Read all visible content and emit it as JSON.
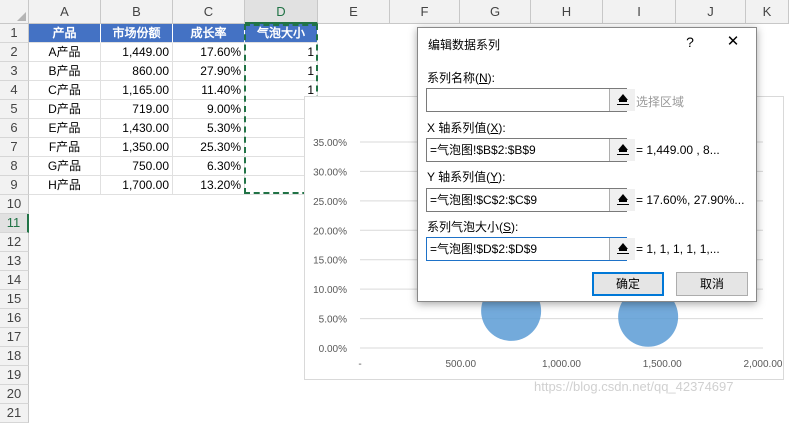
{
  "columns": [
    "A",
    "B",
    "C",
    "D",
    "E",
    "F",
    "G",
    "H",
    "I",
    "J",
    "K"
  ],
  "rows": [
    "1",
    "2",
    "3",
    "4",
    "5",
    "6",
    "7",
    "8",
    "9",
    "10",
    "11",
    "12",
    "13",
    "14",
    "15",
    "16",
    "17",
    "18",
    "19",
    "20",
    "21"
  ],
  "table": {
    "headers": [
      "产品",
      "市场份额",
      "成长率",
      "气泡大小"
    ],
    "rows": [
      [
        "A产品",
        "1,449.00",
        "17.60%",
        "1"
      ],
      [
        "B产品",
        "860.00",
        "27.90%",
        "1"
      ],
      [
        "C产品",
        "1,165.00",
        "11.40%",
        "1"
      ],
      [
        "D产品",
        "719.00",
        "9.00%",
        ""
      ],
      [
        "E产品",
        "1,430.00",
        "5.30%",
        ""
      ],
      [
        "F产品",
        "1,350.00",
        "25.30%",
        ""
      ],
      [
        "G产品",
        "750.00",
        "6.30%",
        ""
      ],
      [
        "H产品",
        "1,700.00",
        "13.20%",
        ""
      ]
    ]
  },
  "chart_data": {
    "type": "scatter",
    "y_ticks": [
      "35.00%",
      "30.00%",
      "25.00%",
      "20.00%",
      "15.00%",
      "10.00%",
      "5.00%",
      "0.00%"
    ],
    "x_ticks": [
      "-",
      "500.00",
      "1,000.00",
      "1,500.00",
      "2,000.00"
    ],
    "xlim": [
      0,
      2000
    ],
    "ylim": [
      0,
      35
    ],
    "bubbles_visible": [
      {
        "x": 750,
        "y": 6.3
      },
      {
        "x": 1430,
        "y": 5.3
      }
    ],
    "bubble_color": "#5b9bd5"
  },
  "dialog": {
    "title": "编辑数据系列",
    "help": "?",
    "close": "✕",
    "name_label_pre": "系列名称(",
    "name_label_key": "N",
    "name_label_post": "):",
    "name_value": "",
    "name_preview": "选择区域",
    "x_label_pre": "X 轴系列值(",
    "x_label_key": "X",
    "x_label_post": "):",
    "x_value": "=气泡图!$B$2:$B$9",
    "x_preview": "=  1,449.00 ,  8...",
    "y_label_pre": "Y 轴系列值(",
    "y_label_key": "Y",
    "y_label_post": "):",
    "y_value": "=气泡图!$C$2:$C$9",
    "y_preview": "= 17.60%, 27.90%...",
    "size_label_pre": "系列气泡大小(",
    "size_label_key": "S",
    "size_label_post": "):",
    "size_value": "=气泡图!$D$2:$D$9",
    "size_preview": "= 1, 1, 1, 1, 1,...",
    "ok": "确定",
    "cancel": "取消"
  },
  "watermark": "https://blog.csdn.net/qq_42374697"
}
